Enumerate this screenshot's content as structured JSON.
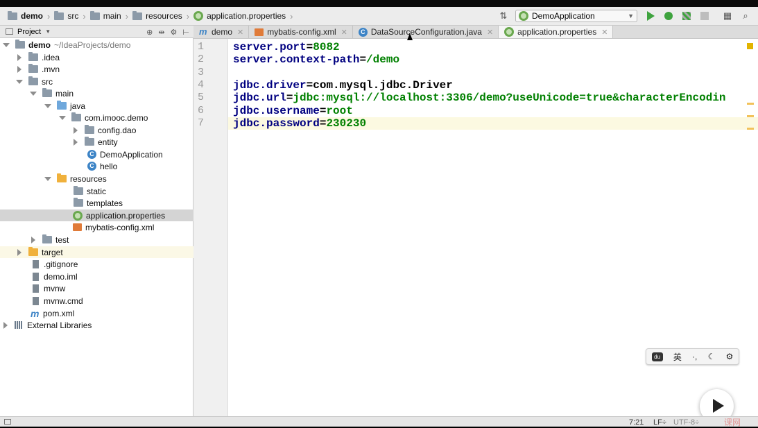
{
  "breadcrumb": [
    "demo",
    "src",
    "main",
    "resources",
    "application.properties"
  ],
  "run_config": "DemoApplication",
  "project_panel": {
    "title": "Project",
    "tree": [
      {
        "label": "demo",
        "suffix": "~/IdeaProjects/demo",
        "icon": "folder-icon",
        "expanded": true,
        "depth": 0,
        "bold": true
      },
      {
        "label": ".idea",
        "icon": "folder-icon",
        "collapsed": true,
        "depth": 1
      },
      {
        "label": ".mvn",
        "icon": "folder-icon",
        "collapsed": true,
        "depth": 1
      },
      {
        "label": "src",
        "icon": "folder-icon",
        "expanded": true,
        "depth": 1
      },
      {
        "label": "main",
        "icon": "folder-icon",
        "expanded": true,
        "depth": 2
      },
      {
        "label": "java",
        "icon": "source-folder-icon",
        "expanded": true,
        "depth": 3
      },
      {
        "label": "com.imooc.demo",
        "icon": "package-icon",
        "expanded": true,
        "depth": 4
      },
      {
        "label": "config.dao",
        "icon": "package-icon",
        "collapsed": true,
        "depth": 5
      },
      {
        "label": "entity",
        "icon": "package-icon",
        "collapsed": true,
        "depth": 5
      },
      {
        "label": "DemoApplication",
        "icon": "spring-class-icon",
        "depth": 5
      },
      {
        "label": "hello",
        "icon": "class-icon",
        "depth": 5
      },
      {
        "label": "resources",
        "icon": "resources-folder-icon",
        "expanded": true,
        "depth": 3
      },
      {
        "label": "static",
        "icon": "folder-icon",
        "depth": 4
      },
      {
        "label": "templates",
        "icon": "folder-icon",
        "depth": 4
      },
      {
        "label": "application.properties",
        "icon": "spring-properties-icon",
        "depth": 4,
        "selected": true
      },
      {
        "label": "mybatis-config.xml",
        "icon": "xml-icon",
        "depth": 4
      },
      {
        "label": "test",
        "icon": "folder-icon",
        "collapsed": true,
        "depth": 2
      },
      {
        "label": "target",
        "icon": "excluded-folder-icon",
        "collapsed": true,
        "depth": 1,
        "highlight": true
      },
      {
        "label": ".gitignore",
        "icon": "file-icon",
        "depth": 1
      },
      {
        "label": "demo.iml",
        "icon": "file-icon",
        "depth": 1
      },
      {
        "label": "mvnw",
        "icon": "file-icon",
        "depth": 1
      },
      {
        "label": "mvnw.cmd",
        "icon": "file-icon",
        "depth": 1
      },
      {
        "label": "pom.xml",
        "icon": "maven-icon",
        "depth": 1
      },
      {
        "label": "External Libraries",
        "icon": "library-icon",
        "collapsed": true,
        "depth": 0
      }
    ]
  },
  "tabs": [
    {
      "label": "demo",
      "icon": "maven-icon",
      "active": false
    },
    {
      "label": "mybatis-config.xml",
      "icon": "xml-icon",
      "active": false
    },
    {
      "label": "DataSourceConfiguration.java",
      "icon": "class-icon",
      "active": false
    },
    {
      "label": "application.properties",
      "icon": "spring-properties-icon",
      "active": true
    }
  ],
  "editor": {
    "line_numbers": [
      "1",
      "2",
      "3",
      "4",
      "5",
      "6",
      "7"
    ],
    "lines": [
      {
        "key": "server.port",
        "value": "8082"
      },
      {
        "key": "server.context-path",
        "value": "/demo"
      },
      {
        "key": "",
        "value": ""
      },
      {
        "key": "jdbc.driver",
        "value": "com.mysql.jdbc.Driver",
        "value_color": "black"
      },
      {
        "key": "jdbc.url",
        "value": "jdbc:mysql://localhost:3306/demo?useUnicode=true&characterEncodin"
      },
      {
        "key": "jdbc.username",
        "value": "root"
      },
      {
        "key": "jdbc.password",
        "value": "230230"
      }
    ],
    "current_line": 7
  },
  "ime_toolbar": {
    "items": [
      "du",
      "英",
      "·,",
      "☾",
      "⚙"
    ]
  },
  "status": {
    "position": "7:21",
    "line_sep": "LF÷",
    "encoding": "UTF-8÷"
  },
  "watermark": "课网"
}
